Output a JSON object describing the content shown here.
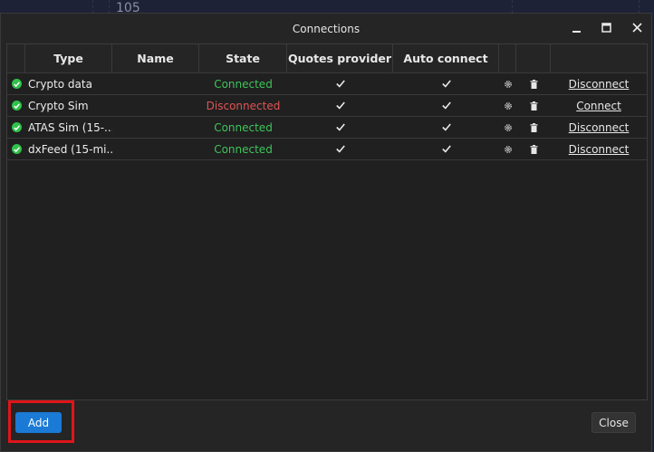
{
  "background": {
    "price_label": "105"
  },
  "window": {
    "title": "Connections",
    "controls": [
      "minimize-icon",
      "maximize-icon",
      "close-icon"
    ]
  },
  "table": {
    "headers": {
      "type": "Type",
      "name": "Name",
      "state": "State",
      "quotes_provider": "Quotes provider",
      "auto_connect": "Auto connect"
    },
    "rows": [
      {
        "type": "Crypto data",
        "name": "",
        "state": "Connected",
        "state_kind": "ok",
        "quotes_provider": true,
        "auto_connect": true,
        "action": "Disconnect"
      },
      {
        "type": "Crypto Sim",
        "name": "",
        "state": "Disconnected",
        "state_kind": "bad",
        "quotes_provider": true,
        "auto_connect": true,
        "action": "Connect"
      },
      {
        "type": "ATAS Sim (15-...",
        "name": "",
        "state": "Connected",
        "state_kind": "ok",
        "quotes_provider": true,
        "auto_connect": true,
        "action": "Disconnect"
      },
      {
        "type": "dxFeed (15-mi...",
        "name": "",
        "state": "Connected",
        "state_kind": "ok",
        "quotes_provider": true,
        "auto_connect": true,
        "action": "Disconnect"
      }
    ]
  },
  "footer": {
    "add_label": "Add",
    "close_label": "Close"
  },
  "colors": {
    "accent": "#1a7ad6",
    "connected": "#3ec35a",
    "disconnected": "#e05454",
    "highlight": "#e0141a"
  }
}
